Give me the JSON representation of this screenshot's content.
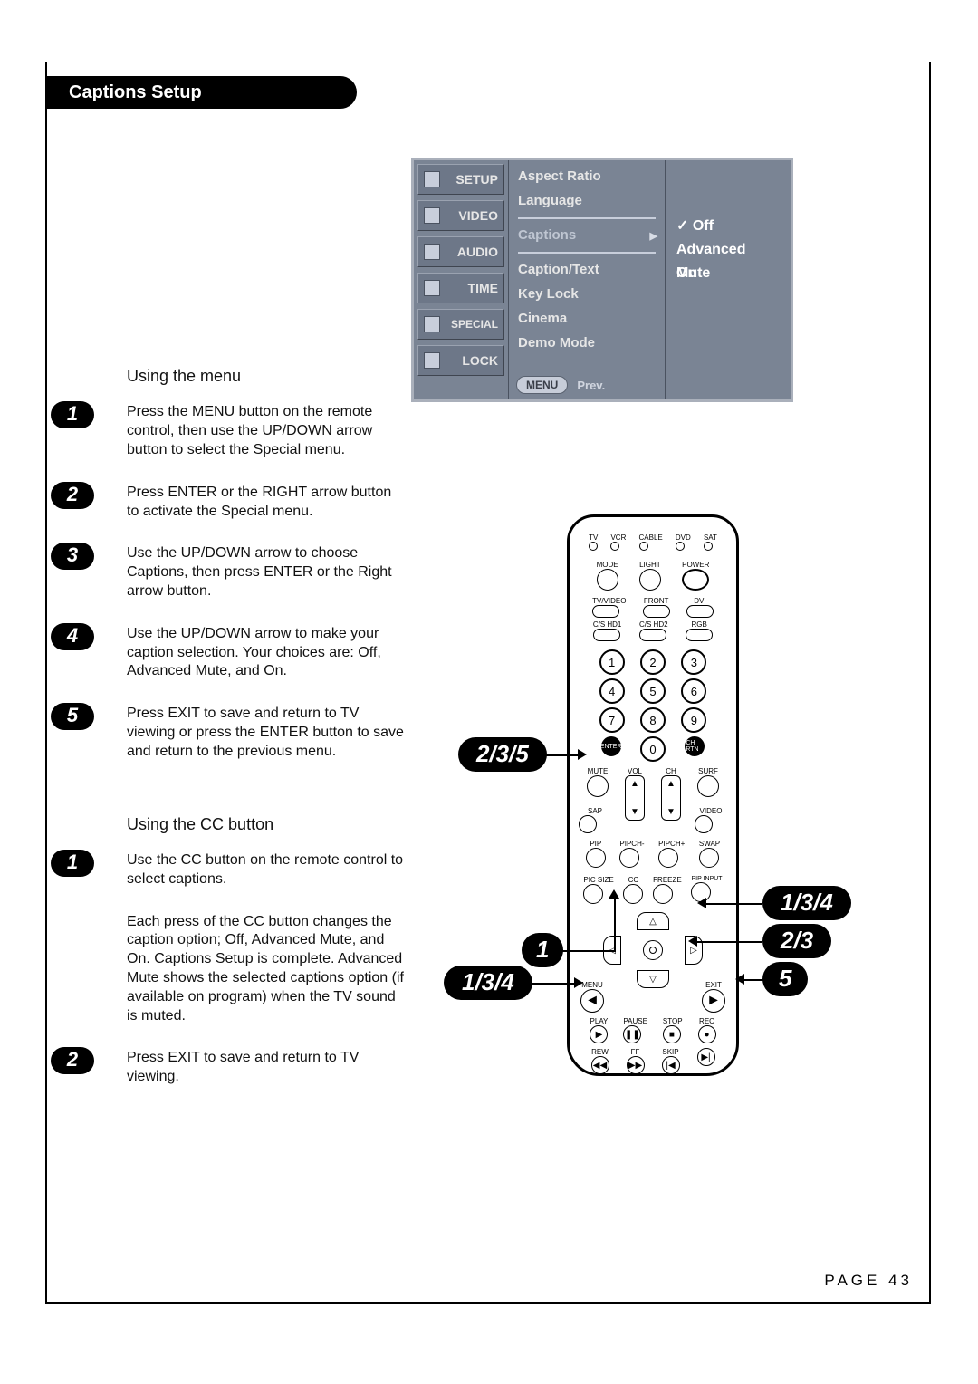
{
  "title": "Captions Setup",
  "osd": {
    "tabs": [
      "SETUP",
      "VIDEO",
      "AUDIO",
      "TIME",
      "SPECIAL",
      "LOCK"
    ],
    "menu_items": [
      "Aspect Ratio",
      "Language",
      "Captions",
      "Caption/Text",
      "Key Lock",
      "Cinema",
      "Demo Mode"
    ],
    "options": [
      "Off",
      "Advanced Mute",
      "On"
    ],
    "footer_menu": "MENU",
    "footer_prev": "Prev."
  },
  "section1_head": "Using the menu",
  "steps1": [
    "Press the MENU button on the remote control, then use the UP/DOWN arrow button to select the Special menu.",
    "Press ENTER or the RIGHT arrow button to activate the Special menu.",
    "Use the UP/DOWN arrow to choose Captions, then press ENTER or the Right arrow button.",
    "Use the UP/DOWN arrow to make your caption selection. Your choices are: Off, Advanced Mute, and On.",
    "Press EXIT to save and return to TV viewing or press the ENTER button to save and return to the previous menu."
  ],
  "section2_head": "Using the CC button",
  "steps2": [
    "Use the CC button on the remote control to select captions.",
    "Press EXIT to save and return to TV viewing."
  ],
  "step2_note": "Each press of the CC button changes the caption option; Off, Advanced Mute, and On. Captions Setup is complete. Advanced Mute shows the selected captions option (if available on program) when the TV sound is muted.",
  "remote": {
    "top_leds": [
      "TV",
      "VCR",
      "CABLE",
      "DVD",
      "SAT"
    ],
    "row2": [
      "MODE",
      "LIGHT",
      "POWER"
    ],
    "row3": [
      "TV/VIDEO",
      "FRONT",
      "DVI"
    ],
    "row4": [
      "C/S HD1",
      "C/S HD2",
      "RGB"
    ],
    "side_enter": "ENTER",
    "side_chrtn": "CH RTN",
    "labels_mid": [
      "MUTE",
      "VOL",
      "CH",
      "SURF"
    ],
    "labels_mid2": [
      "SAP",
      "",
      "",
      "VIDEO"
    ],
    "labels_row": [
      "PIP",
      "PIPCH-",
      "PIPCH+",
      "SWAP"
    ],
    "labels_row2": [
      "PIC SIZE",
      "CC",
      "FREEZE",
      "PIP INPUT"
    ],
    "menu_label": "MENU",
    "exit_label": "EXIT",
    "transport_top": [
      "PLAY",
      "PAUSE",
      "STOP",
      "REC"
    ],
    "transport_bot": [
      "REW",
      "FF",
      "SKIP",
      ""
    ]
  },
  "callouts": {
    "left_mid": "2/3/5",
    "bottom_left": "1/3/4",
    "bottom_center": "1",
    "right_a": "1/3/4",
    "right_b": "2/3",
    "right_c": "5"
  },
  "page_number": "PAGE 43"
}
